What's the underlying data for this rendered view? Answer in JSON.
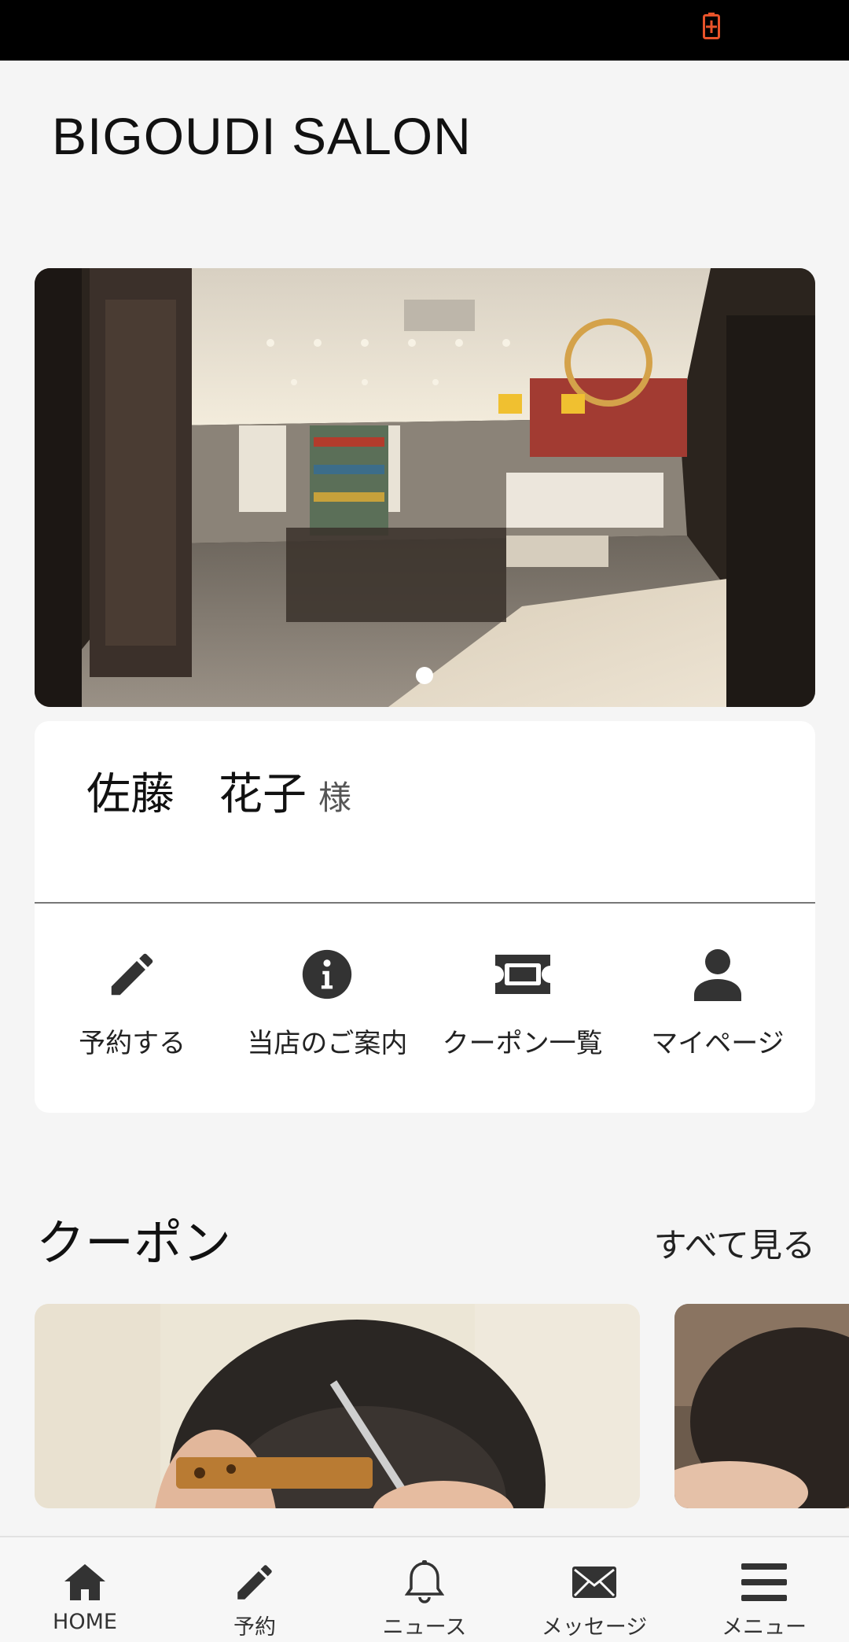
{
  "status_bar": {
    "battery_icon": "battery-charging-icon",
    "battery_color": "#e8532a"
  },
  "header": {
    "title": "BIGOUDI SALON"
  },
  "hero": {
    "image": "salon-interior-photo",
    "slide_count": 1,
    "active_slide": 1
  },
  "profile": {
    "name": "佐藤　花子",
    "honorific": "様"
  },
  "quick_actions": [
    {
      "label": "予約する",
      "icon": "pencil-icon"
    },
    {
      "label": "当店のご案内",
      "icon": "info-icon"
    },
    {
      "label": "クーポン一覧",
      "icon": "ticket-icon"
    },
    {
      "label": "マイページ",
      "icon": "person-icon"
    }
  ],
  "coupons_section": {
    "title": "クーポン",
    "see_all": "すべて見る",
    "items": [
      {
        "image": "haircut-comb-photo"
      },
      {
        "image": "haircut-photo"
      }
    ]
  },
  "bottom_nav": [
    {
      "label": "HOME",
      "icon": "home-icon"
    },
    {
      "label": "予約",
      "icon": "pencil-icon"
    },
    {
      "label": "ニュース",
      "icon": "bell-icon"
    },
    {
      "label": "メッセージ",
      "icon": "envelope-icon"
    },
    {
      "label": "メニュー",
      "icon": "hamburger-menu-icon"
    }
  ]
}
